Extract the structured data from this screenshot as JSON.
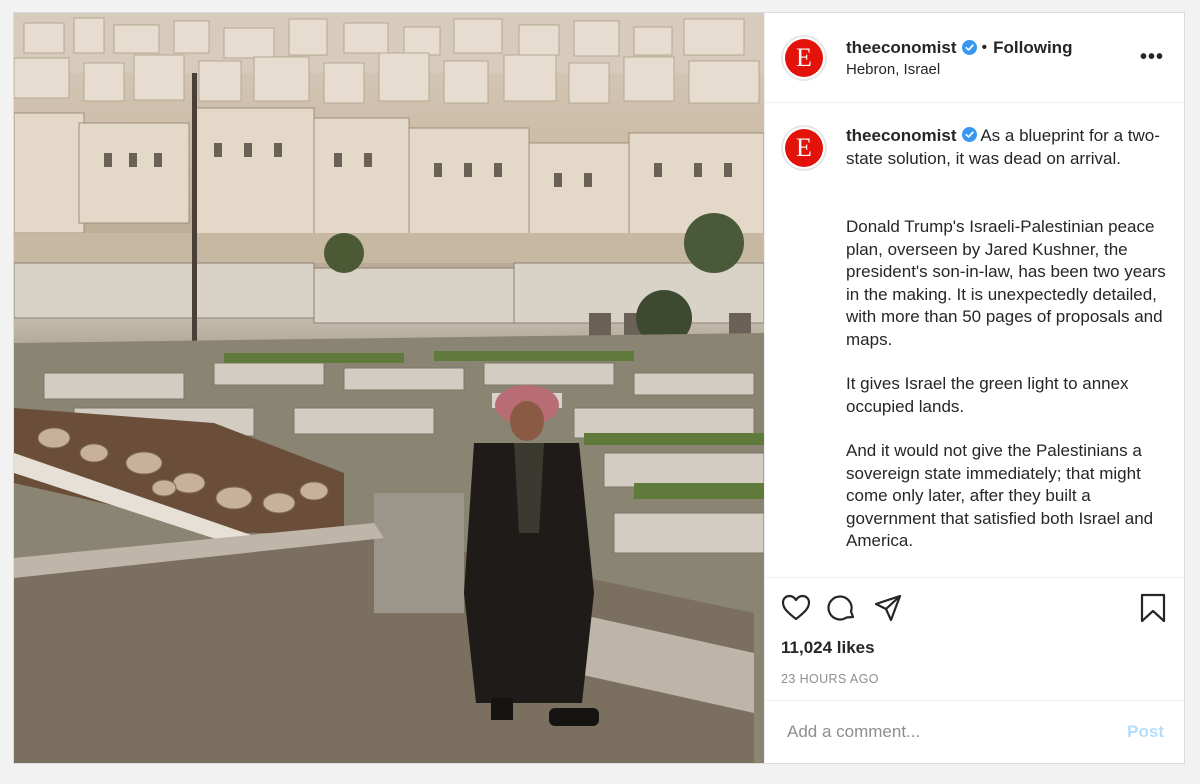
{
  "post": {
    "username": "theeconomist",
    "verified": true,
    "bullet": "•",
    "follow_status": "Following",
    "location": "Hebron, Israel",
    "more_menu": "•••",
    "avatar_letter": "E",
    "brand_color": "#e3120b",
    "caption": {
      "username": "theeconomist",
      "lead": "As a blueprint for a two-state solution, it was dead on arrival.",
      "paragraphs": [
        "Donald Trump's Israeli-Palestinian peace plan, overseen by Jared Kushner, the president's son-in-law, has been two years in the making. It is unexpectedly detailed, with more than 50 pages of proposals and maps.",
        "It gives Israel the green light to annex occupied lands.",
        "And it would not give the Palestinians a sovereign state immediately; that might come only later, after they built a government that satisfied both Israel and America."
      ]
    },
    "likes": "11,024 likes",
    "timestamp": "23 HOURS AGO",
    "comment_placeholder": "Add a comment...",
    "post_button": "Post",
    "icons": [
      "heart-icon",
      "comment-icon",
      "share-icon",
      "bookmark-icon"
    ]
  }
}
